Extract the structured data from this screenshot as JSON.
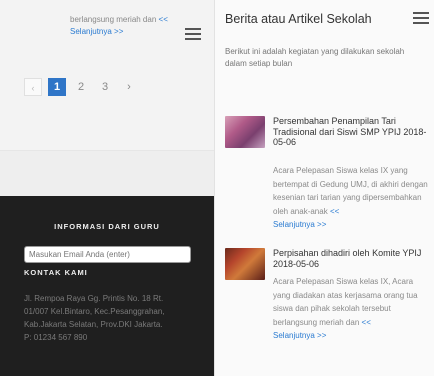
{
  "left": {
    "snippet_text": "berlangsung meriah dan",
    "snippet_arrows": "<<",
    "snippet_link": "Selanjutnya >>",
    "pagination": {
      "prev": "‹",
      "pages": [
        "1",
        "2",
        "3"
      ],
      "active": "1",
      "next": "›"
    },
    "footer": {
      "info_heading": "INFORMASI DARI GURU",
      "email_placeholder": "Masukan Email Anda (enter)",
      "contact_heading": "KONTAK KAMI",
      "address_lines": [
        "Jl. Rempoa Raya Gg. Printis No. 18 Rt.",
        "01/007 Kel.Bintaro, Kec.Pesanggrahan,",
        "Kab.Jakarta Selatan, Prov.DKI Jakarta.",
        "P: 01234 567 890"
      ]
    }
  },
  "right": {
    "title": "Berita atau Artikel Sekolah",
    "intro": "Berikut ini adalah kegiatan yang dilakukan sekolah dalam setiap bulan",
    "articles": [
      {
        "title": "Persembahan Penampilan Tari Tradisional dari Siswi SMP YPIJ 2018-05-06",
        "excerpt": "Acara Pelepasan Siswa kelas IX yang bertempat di Gedung UMJ, di akhiri dengan kesenian tari tarian yang dipersembahkan oleh anak-anak",
        "arrows": "<<",
        "link": "Selanjutnya >>"
      },
      {
        "title": "Perpisahan dihadiri oleh Komite YPIJ 2018-05-06",
        "excerpt": "Acara Pelepasan Siswa kelas IX, Acara yang diadakan atas kerjasama orang tua siswa dan pihak sekolah tersebut berlangsung meriah dan",
        "arrows": "<<",
        "link": "Selanjutnya >>"
      }
    ]
  },
  "colors": {
    "accent": "#2f75c7",
    "link": "#2a7bd1",
    "footer_bg": "#1f1f1f"
  },
  "icons": [
    "hamburger-menu-icon",
    "article-thumbnail-image"
  ]
}
